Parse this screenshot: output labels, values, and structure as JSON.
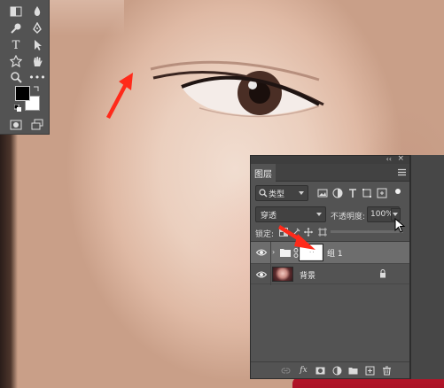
{
  "panel": {
    "tab_label": "图层",
    "filter": {
      "selected": "类型"
    },
    "blend_mode": {
      "selected": "穿透"
    },
    "opacity": {
      "label": "不透明度:",
      "value": "100%"
    },
    "lock": {
      "label": "锁定:"
    },
    "fill_level": 0.0,
    "layers": [
      {
        "name": "组 1",
        "kind": "group",
        "visible": true,
        "selected": true,
        "has_mask": true
      },
      {
        "name": "背景",
        "kind": "background",
        "visible": true,
        "selected": false,
        "locked": true
      }
    ]
  },
  "footer_icons": [
    "link-layers-icon",
    "fx-icon",
    "add-mask-icon",
    "adjustment-layer-icon",
    "new-group-icon",
    "new-layer-icon",
    "delete-layer-icon"
  ],
  "annotation": {
    "arrow_color": "#ff2a1a"
  },
  "colors": {
    "panel_bg": "#535353",
    "selected_row": "#6d6d6d",
    "lip_red": "#c0182d"
  }
}
